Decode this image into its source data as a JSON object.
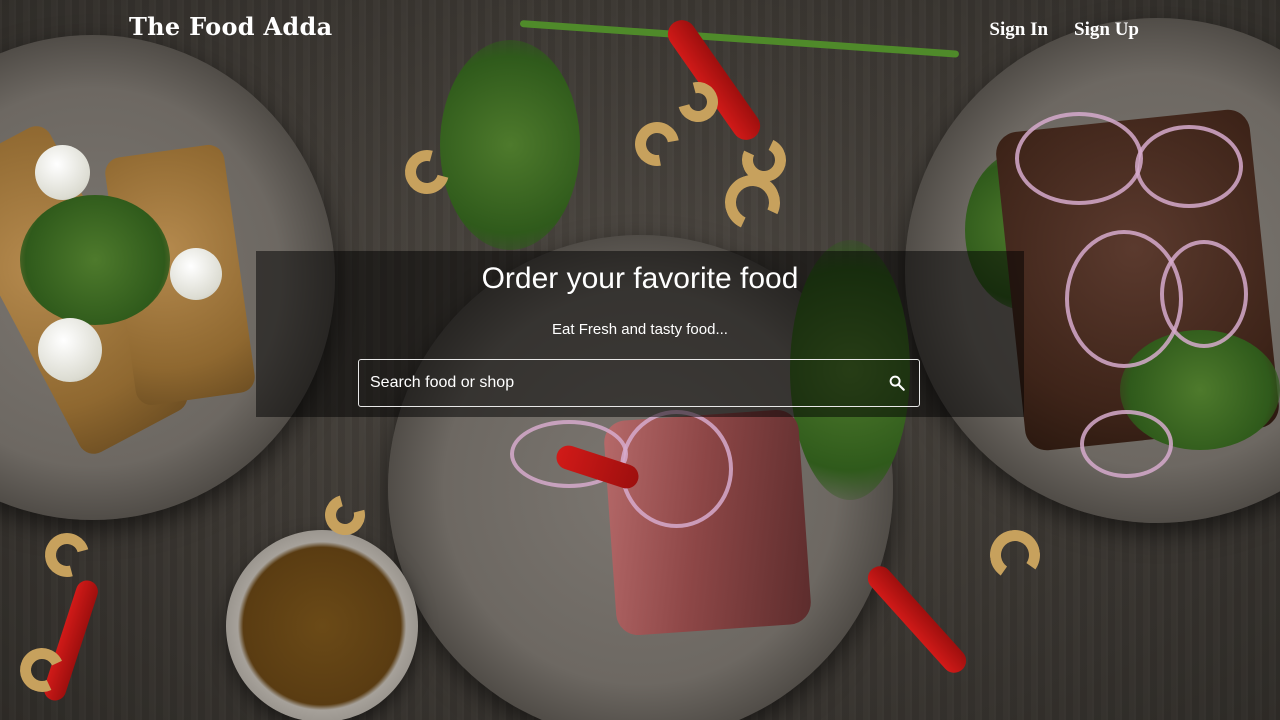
{
  "navbar": {
    "brand": "The Food Adda",
    "sign_in_label": "Sign In",
    "sign_up_label": "Sign Up"
  },
  "hero": {
    "title": "Order your favorite food",
    "subtitle": "Eat Fresh and tasty food...",
    "search": {
      "value": "",
      "placeholder": "Search food or shop",
      "button_icon": "search-icon"
    },
    "background_image": "food-plates-photo"
  },
  "colors": {
    "overlay": "#000000",
    "text": "#ffffff",
    "search_border": "#e8e8e8"
  }
}
